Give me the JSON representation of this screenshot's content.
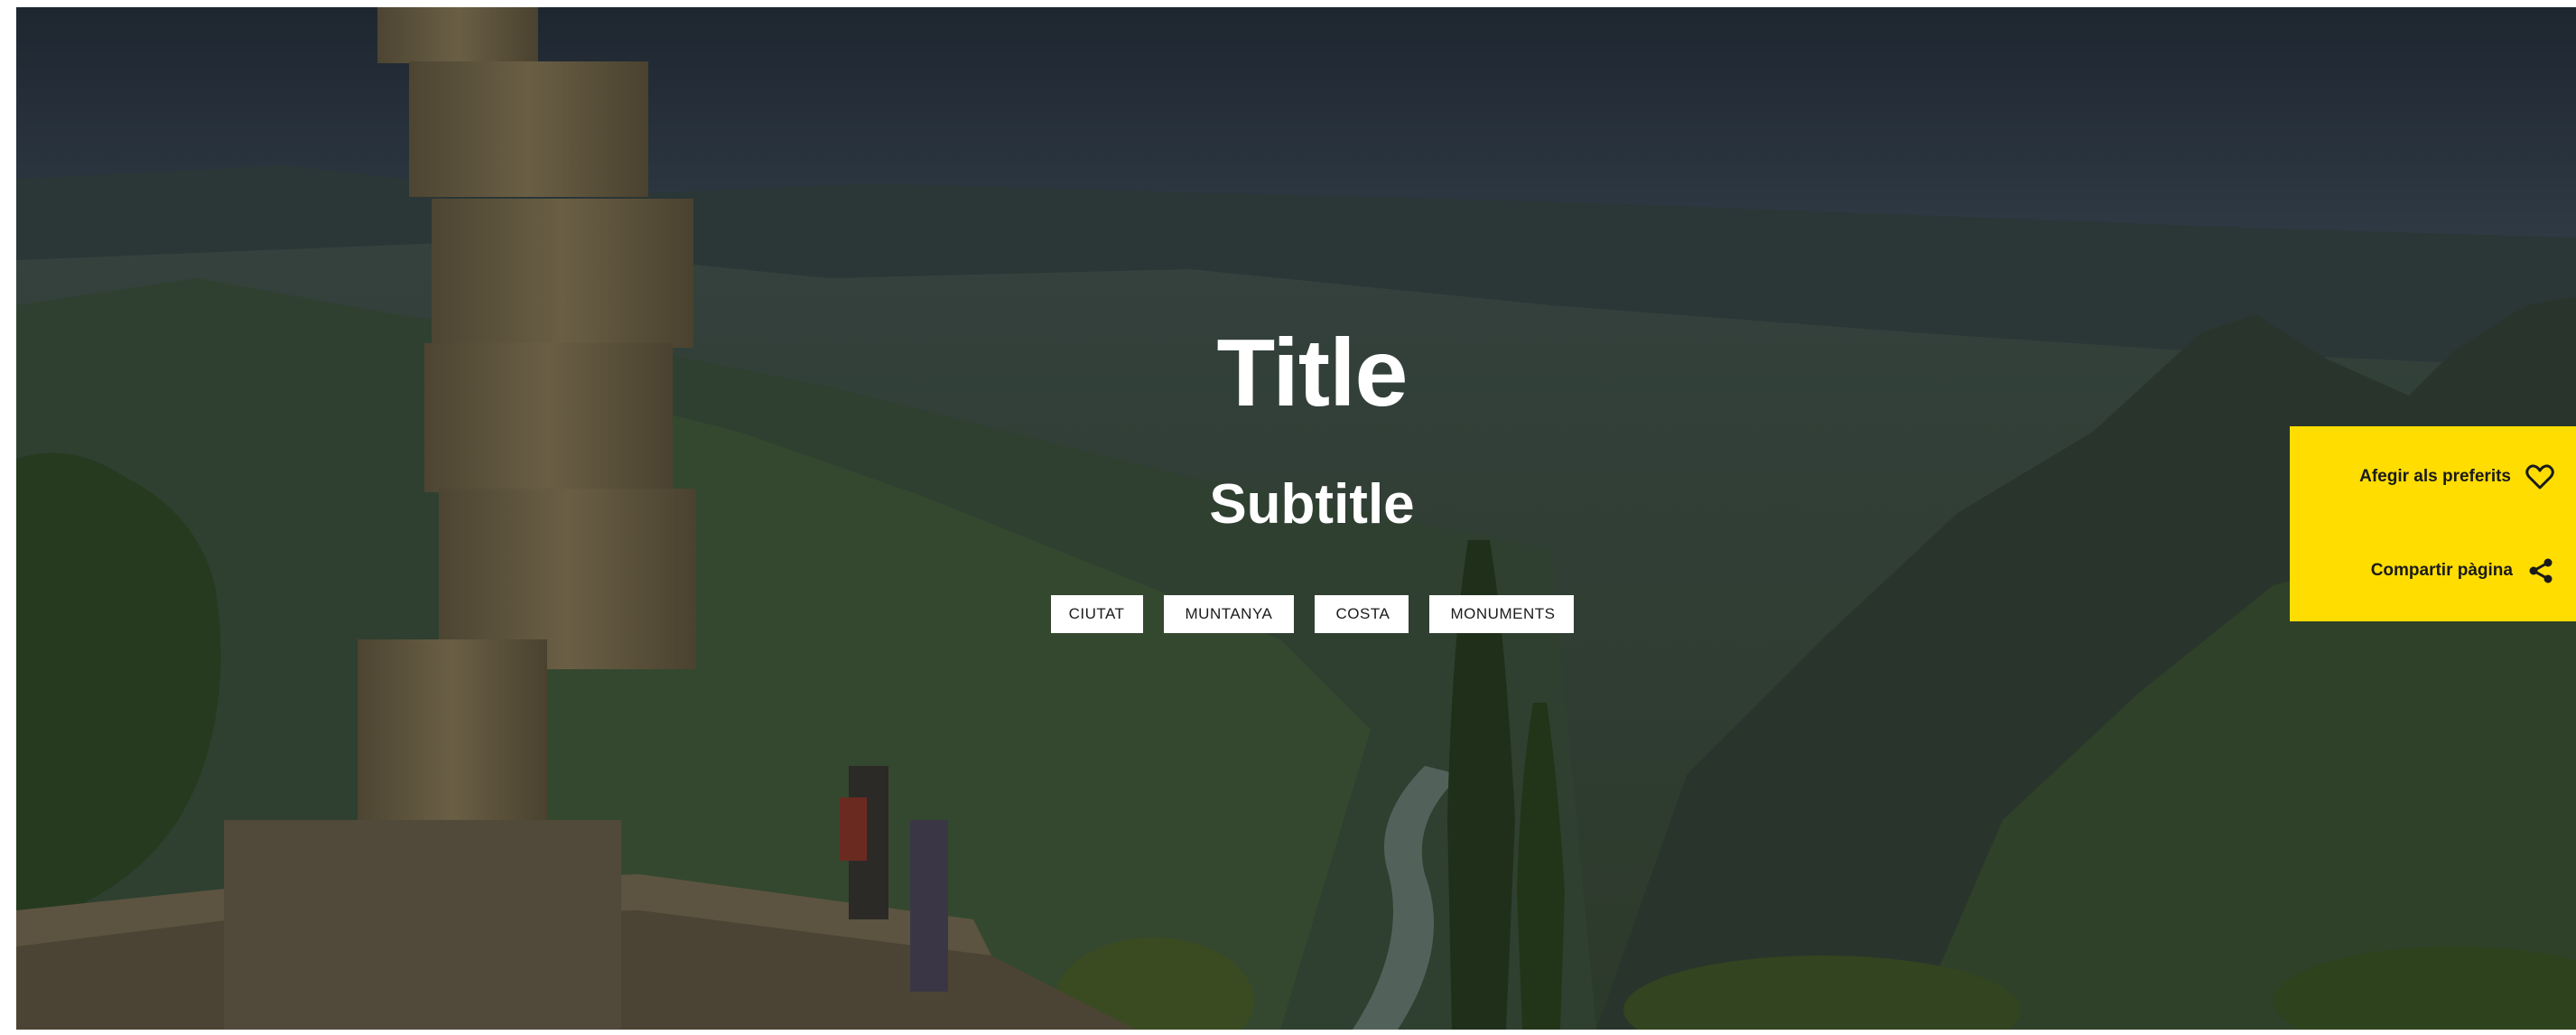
{
  "hero": {
    "title": "Title",
    "subtitle": "Subtitle",
    "tags": [
      "CIUTAT",
      "MUNTANYA",
      "COSTA",
      "MONUMENTS"
    ]
  },
  "actions": {
    "favorites_label": "Afegir als preferits",
    "favorites_icon": "heart-icon",
    "share_label": "Compartir pàgina",
    "share_icon": "share-icon"
  },
  "colors": {
    "accent": "#ffdd00",
    "tag_background": "#ffffff",
    "text_on_image": "#ffffff"
  }
}
